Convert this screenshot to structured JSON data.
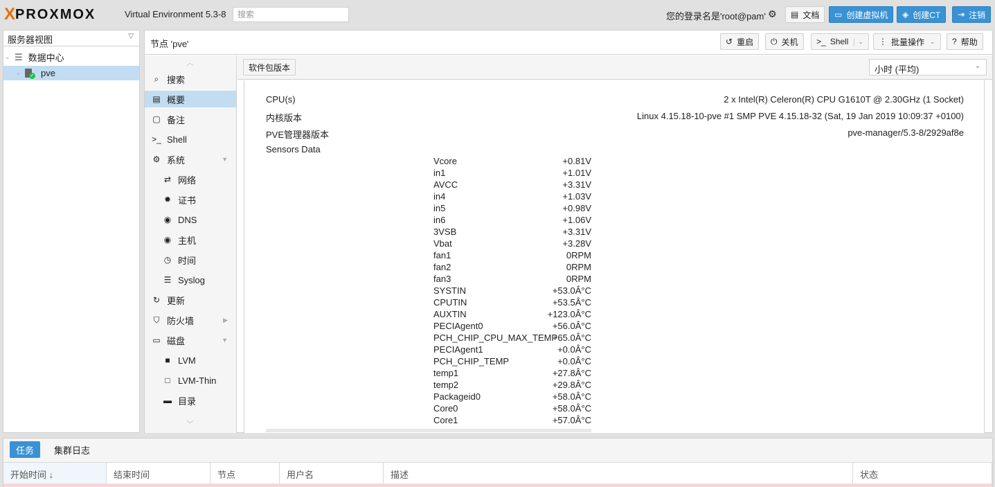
{
  "brand": {
    "logo_x": "X",
    "logo_word": "PROXMOX",
    "version": "Virtual Environment 5.3-8"
  },
  "search": {
    "placeholder": "搜索"
  },
  "header": {
    "logged_in": "您的登录名是'root@pam'",
    "docs_label": "文档",
    "create_vm_label": "创建虚拟机",
    "create_ct_label": "创建CT",
    "logout_label": "注销"
  },
  "tree": {
    "view_label": "服务器视图",
    "datacenter": "数据中心",
    "node": "pve"
  },
  "node_header": {
    "title": "节点 'pve'",
    "restart_label": "重启",
    "shutdown_label": "关机",
    "shell_label": "Shell",
    "bulk_label": "批量操作",
    "help_label": "帮助"
  },
  "nav": {
    "items": [
      {
        "label": "搜索",
        "icon": "search-icon",
        "glyph": "⌕"
      },
      {
        "label": "概要",
        "icon": "book-icon",
        "glyph": "▤"
      },
      {
        "label": "备注",
        "icon": "note-icon",
        "glyph": "▢"
      },
      {
        "label": "Shell",
        "icon": "terminal-icon",
        "glyph": ">_"
      },
      {
        "label": "系统",
        "icon": "cogs-icon",
        "glyph": "⚙"
      },
      {
        "label": "网络",
        "icon": "exchange-icon",
        "glyph": "⇄"
      },
      {
        "label": "证书",
        "icon": "certificate-icon",
        "glyph": "✹"
      },
      {
        "label": "DNS",
        "icon": "globe-icon",
        "glyph": "◉"
      },
      {
        "label": "主机",
        "icon": "globe-icon",
        "glyph": "◉"
      },
      {
        "label": "时间",
        "icon": "clock-icon",
        "glyph": "◷"
      },
      {
        "label": "Syslog",
        "icon": "list-icon",
        "glyph": "☰"
      },
      {
        "label": "更新",
        "icon": "refresh-icon",
        "glyph": "↻"
      },
      {
        "label": "防火墙",
        "icon": "shield-icon",
        "glyph": "⛉"
      },
      {
        "label": "磁盘",
        "icon": "hdd-icon",
        "glyph": "▭"
      },
      {
        "label": "LVM",
        "icon": "square-icon",
        "glyph": "■"
      },
      {
        "label": "LVM-Thin",
        "icon": "square-outline-icon",
        "glyph": "□"
      },
      {
        "label": "目录",
        "icon": "folder-icon",
        "glyph": "▬"
      }
    ]
  },
  "content": {
    "pkg_versions_label": "软件包版本",
    "timeframe": "小时 (平均)",
    "rows": [
      {
        "key": "CPU(s)",
        "value": "2 x Intel(R) Celeron(R) CPU G1610T @ 2.30GHz (1 Socket)"
      },
      {
        "key": "内核版本",
        "value": "Linux 4.15.18-10-pve #1 SMP PVE 4.15.18-32 (Sat, 19 Jan 2019 10:09:37 +0100)"
      },
      {
        "key": "PVE管理器版本",
        "value": "pve-manager/5.3-8/2929af8e"
      },
      {
        "key": "Sensors Data",
        "value": ""
      }
    ],
    "sensors": [
      {
        "name": "Vcore",
        "value": "+0.81V"
      },
      {
        "name": "in1",
        "value": "+1.01V"
      },
      {
        "name": "AVCC",
        "value": "+3.31V"
      },
      {
        "name": "in4",
        "value": "+1.03V"
      },
      {
        "name": "in5",
        "value": "+0.98V"
      },
      {
        "name": "in6",
        "value": "+1.06V"
      },
      {
        "name": "3VSB",
        "value": "+3.31V"
      },
      {
        "name": "Vbat",
        "value": "+3.28V"
      },
      {
        "name": "fan1",
        "value": "0RPM"
      },
      {
        "name": "fan2",
        "value": "0RPM"
      },
      {
        "name": "fan3",
        "value": "0RPM"
      },
      {
        "name": "SYSTIN",
        "value": "+53.0Â°C"
      },
      {
        "name": "CPUTIN",
        "value": "+53.5Â°C"
      },
      {
        "name": "AUXTIN",
        "value": "+123.0Â°C"
      },
      {
        "name": "PECIAgent0",
        "value": "+56.0Â°C"
      },
      {
        "name": "PCH_CHIP_CPU_MAX_TEMP",
        "value": "+65.0Â°C"
      },
      {
        "name": "PECIAgent1",
        "value": "+0.0Â°C"
      },
      {
        "name": "PCH_CHIP_TEMP",
        "value": "+0.0Â°C"
      },
      {
        "name": "temp1",
        "value": "+27.8Â°C"
      },
      {
        "name": "temp2",
        "value": "+29.8Â°C"
      },
      {
        "name": "Packageid0",
        "value": "+58.0Â°C"
      },
      {
        "name": "Core0",
        "value": "+58.0Â°C"
      },
      {
        "name": "Core1",
        "value": "+57.0Â°C"
      }
    ]
  },
  "bottom": {
    "tasks_tab": "任务",
    "cluster_log_tab": "集群日志",
    "columns": [
      "开始时间 ↓",
      "结束时间",
      "节点",
      "用户名",
      "描述",
      "状态"
    ]
  },
  "colors": {
    "accent": "#3892d4",
    "logo_orange": "#e57000",
    "selected": "#c2ddf2"
  }
}
